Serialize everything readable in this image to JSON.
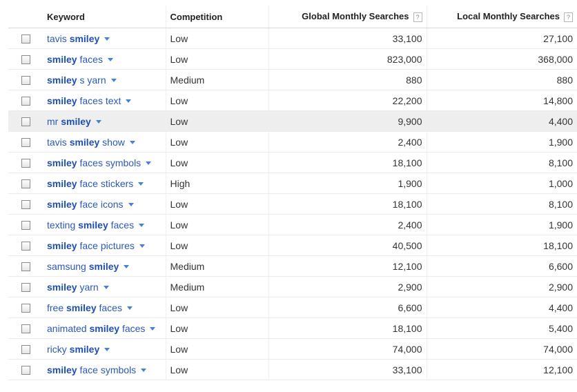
{
  "headers": {
    "keyword": "Keyword",
    "competition": "Competition",
    "global": "Global Monthly Searches",
    "local": "Local Monthly Searches",
    "help_glyph": "?"
  },
  "rows": [
    {
      "parts": [
        {
          "t": "tavis ",
          "b": false
        },
        {
          "t": "smiley",
          "b": true
        }
      ],
      "competition": "Low",
      "global": "33,100",
      "local": "27,100",
      "highlighted": false
    },
    {
      "parts": [
        {
          "t": "smiley",
          "b": true
        },
        {
          "t": " faces",
          "b": false
        }
      ],
      "competition": "Low",
      "global": "823,000",
      "local": "368,000",
      "highlighted": false
    },
    {
      "parts": [
        {
          "t": "smiley",
          "b": true
        },
        {
          "t": " s yarn",
          "b": false
        }
      ],
      "competition": "Medium",
      "global": "880",
      "local": "880",
      "highlighted": false
    },
    {
      "parts": [
        {
          "t": "smiley",
          "b": true
        },
        {
          "t": " faces text",
          "b": false
        }
      ],
      "competition": "Low",
      "global": "22,200",
      "local": "14,800",
      "highlighted": false
    },
    {
      "parts": [
        {
          "t": "mr ",
          "b": false
        },
        {
          "t": "smiley",
          "b": true
        }
      ],
      "competition": "Low",
      "global": "9,900",
      "local": "4,400",
      "highlighted": true
    },
    {
      "parts": [
        {
          "t": "tavis ",
          "b": false
        },
        {
          "t": "smiley",
          "b": true
        },
        {
          "t": " show",
          "b": false
        }
      ],
      "competition": "Low",
      "global": "2,400",
      "local": "1,900",
      "highlighted": false
    },
    {
      "parts": [
        {
          "t": "smiley",
          "b": true
        },
        {
          "t": " faces symbols",
          "b": false
        }
      ],
      "competition": "Low",
      "global": "18,100",
      "local": "8,100",
      "highlighted": false
    },
    {
      "parts": [
        {
          "t": "smiley",
          "b": true
        },
        {
          "t": " face stickers",
          "b": false
        }
      ],
      "competition": "High",
      "global": "1,900",
      "local": "1,000",
      "highlighted": false
    },
    {
      "parts": [
        {
          "t": "smiley",
          "b": true
        },
        {
          "t": " face icons",
          "b": false
        }
      ],
      "competition": "Low",
      "global": "18,100",
      "local": "8,100",
      "highlighted": false
    },
    {
      "parts": [
        {
          "t": "texting ",
          "b": false
        },
        {
          "t": "smiley",
          "b": true
        },
        {
          "t": " faces",
          "b": false
        }
      ],
      "competition": "Low",
      "global": "2,400",
      "local": "1,900",
      "highlighted": false
    },
    {
      "parts": [
        {
          "t": "smiley",
          "b": true
        },
        {
          "t": " face pictures",
          "b": false
        }
      ],
      "competition": "Low",
      "global": "40,500",
      "local": "18,100",
      "highlighted": false
    },
    {
      "parts": [
        {
          "t": "samsung ",
          "b": false
        },
        {
          "t": "smiley",
          "b": true
        }
      ],
      "competition": "Medium",
      "global": "12,100",
      "local": "6,600",
      "highlighted": false
    },
    {
      "parts": [
        {
          "t": "smiley",
          "b": true
        },
        {
          "t": " yarn",
          "b": false
        }
      ],
      "competition": "Medium",
      "global": "2,900",
      "local": "2,900",
      "highlighted": false
    },
    {
      "parts": [
        {
          "t": "free ",
          "b": false
        },
        {
          "t": "smiley",
          "b": true
        },
        {
          "t": " faces",
          "b": false
        }
      ],
      "competition": "Low",
      "global": "6,600",
      "local": "4,400",
      "highlighted": false
    },
    {
      "parts": [
        {
          "t": "animated ",
          "b": false
        },
        {
          "t": "smiley",
          "b": true
        },
        {
          "t": " faces",
          "b": false
        }
      ],
      "competition": "Low",
      "global": "18,100",
      "local": "5,400",
      "highlighted": false
    },
    {
      "parts": [
        {
          "t": "ricky ",
          "b": false
        },
        {
          "t": "smiley",
          "b": true
        }
      ],
      "competition": "Low",
      "global": "74,000",
      "local": "74,000",
      "highlighted": false
    },
    {
      "parts": [
        {
          "t": "smiley",
          "b": true
        },
        {
          "t": " face symbols",
          "b": false
        }
      ],
      "competition": "Low",
      "global": "33,100",
      "local": "12,100",
      "highlighted": false
    }
  ]
}
